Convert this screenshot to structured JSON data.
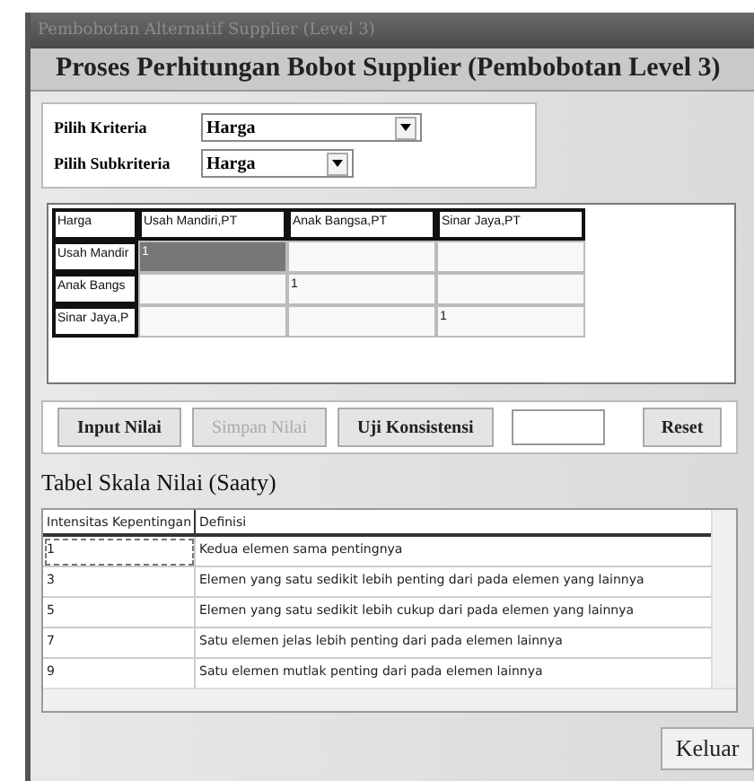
{
  "window": {
    "title": "Pembobotan Alternatif Supplier (Level 3)"
  },
  "header": "Proses Perhitungan Bobot Supplier (Pembobotan Level 3)",
  "selectors": [
    {
      "label": "Pilih Kriteria",
      "value": "Harga"
    },
    {
      "label": "Pilih Subkriteria",
      "value": "Harga"
    }
  ],
  "matrix": {
    "corner": "Harga",
    "columns": [
      "Usah Mandiri,PT",
      "Anak Bangsa,PT",
      "Sinar Jaya,PT"
    ],
    "rows": [
      {
        "header": "Usah Mandir",
        "cells": [
          {
            "value": "1",
            "selected": true
          },
          {
            "selected": false
          },
          {
            "selected": false
          }
        ]
      },
      {
        "header": "Anak Bangs",
        "cells": [
          {
            "selected": false
          },
          {
            "value": "1",
            "selected": false
          },
          {
            "selected": false
          }
        ]
      },
      {
        "header": "Sinar Jaya,P",
        "cells": [
          {
            "selected": false
          },
          {
            "selected": false
          },
          {
            "value": "1",
            "selected": false
          }
        ]
      }
    ]
  },
  "buttons": [
    {
      "label": "Input Nilai",
      "disabled": false
    },
    {
      "label": "Simpan Nilai",
      "disabled": true
    },
    {
      "label": "Uji Konsistensi",
      "disabled": false
    }
  ],
  "reset_button": "Reset",
  "scale_title": "Tabel Skala Nilai (Saaty)",
  "scale_table": {
    "columns": [
      "Intensitas Kepentingan",
      "Definisi"
    ],
    "rows": [
      [
        "1",
        "Kedua elemen sama pentingnya"
      ],
      [
        "3",
        "Elemen yang satu sedikit lebih penting dari pada elemen yang lainnya"
      ],
      [
        "5",
        "Elemen yang satu sedikit lebih cukup dari pada elemen yang lainnya"
      ],
      [
        "7",
        "Satu elemen jelas lebih penting dari pada elemen lainnya"
      ],
      [
        "9",
        "Satu elemen mutlak penting dari pada elemen lainnya"
      ]
    ]
  },
  "exit_button": "Keluar"
}
